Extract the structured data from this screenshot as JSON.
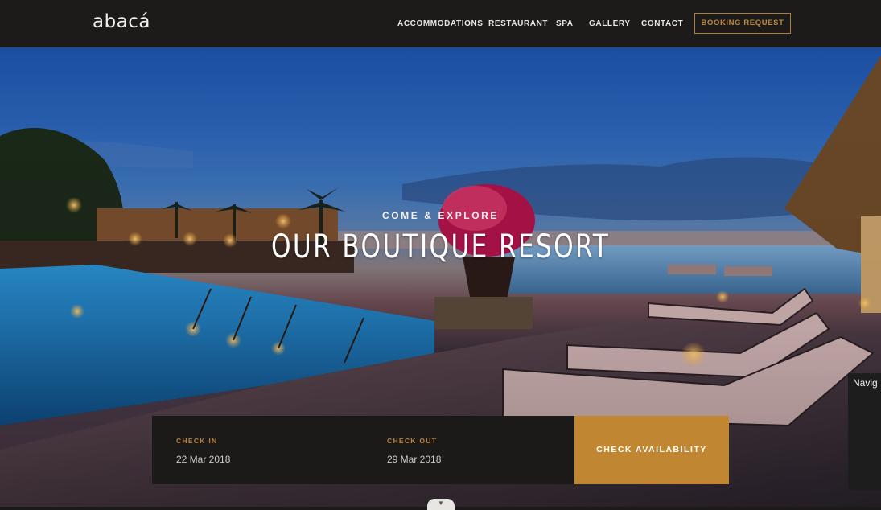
{
  "brand": {
    "logo_text": "abacá"
  },
  "nav": {
    "items": [
      {
        "label": "ACCOMMODATIONS"
      },
      {
        "label": "RESTAURANT"
      },
      {
        "label": "SPA"
      },
      {
        "label": "GALLERY"
      },
      {
        "label": "CONTACT"
      }
    ],
    "booking_request_label": "BOOKING REQUEST"
  },
  "hero": {
    "eyebrow": "COME & EXPLORE",
    "title": "OUR BOUTIQUE RESORT"
  },
  "booking": {
    "check_in": {
      "label": "CHECK IN",
      "value": "22 Mar 2018"
    },
    "check_out": {
      "label": "CHECK OUT",
      "value": "29 Mar 2018"
    },
    "button_label": "CHECK AVAILABILITY"
  },
  "side_panel": {
    "label": "Navig"
  },
  "colors": {
    "accent": "#c08632",
    "header_bg": "#1c1b1a",
    "nav_text": "#e9e6e0"
  },
  "icons": {
    "scroll_down": "chevron-down-icon"
  }
}
